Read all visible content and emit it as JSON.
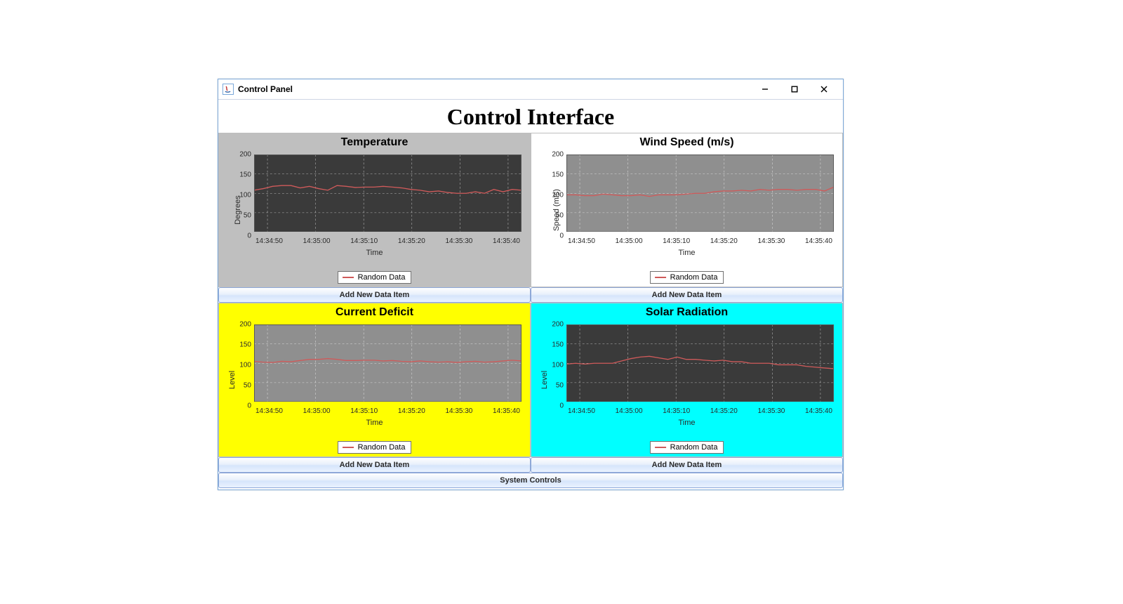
{
  "window": {
    "title": "Control Panel"
  },
  "header": {
    "title": "Control Interface"
  },
  "buttons": {
    "add_data": "Add New Data Item",
    "system_controls": "System Controls"
  },
  "chart_data": [
    {
      "id": "temperature",
      "type": "line",
      "title": "Temperature",
      "xlabel": "Time",
      "ylabel": "Degrees",
      "ylim": [
        0,
        200
      ],
      "yticks": [
        0,
        50,
        100,
        150,
        200
      ],
      "categories": [
        "14:34:50",
        "14:35:00",
        "14:35:10",
        "14:35:20",
        "14:35:30",
        "14:35:40"
      ],
      "series": [
        {
          "name": "Random Data",
          "color": "#cf5a5a",
          "x": [
            "14:34:46",
            "14:34:48",
            "14:34:50",
            "14:34:52",
            "14:34:54",
            "14:34:56",
            "14:34:58",
            "14:35:00",
            "14:35:02",
            "14:35:04",
            "14:35:06",
            "14:35:08",
            "14:35:10",
            "14:35:12",
            "14:35:14",
            "14:35:16",
            "14:35:18",
            "14:35:20",
            "14:35:22",
            "14:35:24",
            "14:35:26",
            "14:35:28",
            "14:35:30",
            "14:35:32",
            "14:35:34",
            "14:35:36",
            "14:35:38",
            "14:35:40",
            "14:35:42",
            "14:35:44"
          ],
          "values": [
            108,
            112,
            118,
            120,
            120,
            114,
            118,
            112,
            108,
            120,
            118,
            115,
            116,
            116,
            118,
            116,
            114,
            110,
            108,
            104,
            106,
            102,
            100,
            100,
            104,
            100,
            110,
            104,
            110,
            108
          ]
        }
      ],
      "panel_bg": "#bfbfbf",
      "plot_bg": "#3a3a3a",
      "grid_color": "#b5b5b5"
    },
    {
      "id": "wind",
      "type": "line",
      "title": "Wind Speed (m/s)",
      "xlabel": "Time",
      "ylabel": "Speed (m/s)",
      "ylim": [
        0,
        200
      ],
      "yticks": [
        0,
        50,
        100,
        150,
        200
      ],
      "categories": [
        "14:34:50",
        "14:35:00",
        "14:35:10",
        "14:35:20",
        "14:35:30",
        "14:35:40"
      ],
      "series": [
        {
          "name": "Random Data",
          "color": "#cf5a5a",
          "x": [
            "14:34:46",
            "14:34:48",
            "14:34:50",
            "14:34:52",
            "14:34:54",
            "14:34:56",
            "14:34:58",
            "14:35:00",
            "14:35:02",
            "14:35:04",
            "14:35:06",
            "14:35:08",
            "14:35:10",
            "14:35:12",
            "14:35:14",
            "14:35:16",
            "14:35:18",
            "14:35:20",
            "14:35:22",
            "14:35:24",
            "14:35:26",
            "14:35:28",
            "14:35:30",
            "14:35:32",
            "14:35:34",
            "14:35:36",
            "14:35:38",
            "14:35:40",
            "14:35:42",
            "14:35:44"
          ],
          "values": [
            96,
            96,
            94,
            94,
            98,
            96,
            94,
            94,
            96,
            92,
            96,
            96,
            96,
            98,
            100,
            100,
            104,
            106,
            106,
            108,
            106,
            110,
            108,
            110,
            110,
            108,
            110,
            110,
            106,
            116
          ]
        }
      ],
      "panel_bg": "#ffffff",
      "plot_bg": "#8f8f8f",
      "grid_color": "#d9d9d9"
    },
    {
      "id": "deficit",
      "type": "line",
      "title": "Current Deficit",
      "xlabel": "Time",
      "ylabel": "Level",
      "ylim": [
        0,
        200
      ],
      "yticks": [
        0,
        50,
        100,
        150,
        200
      ],
      "categories": [
        "14:34:50",
        "14:35:00",
        "14:35:10",
        "14:35:20",
        "14:35:30",
        "14:35:40"
      ],
      "series": [
        {
          "name": "Random Data",
          "color": "#cf5a5a",
          "x": [
            "14:34:46",
            "14:34:48",
            "14:34:50",
            "14:34:52",
            "14:34:54",
            "14:34:56",
            "14:34:58",
            "14:35:00",
            "14:35:02",
            "14:35:04",
            "14:35:06",
            "14:35:08",
            "14:35:10",
            "14:35:12",
            "14:35:14",
            "14:35:16",
            "14:35:18",
            "14:35:20",
            "14:35:22",
            "14:35:24",
            "14:35:26",
            "14:35:28",
            "14:35:30",
            "14:35:32",
            "14:35:34",
            "14:35:36",
            "14:35:38",
            "14:35:40",
            "14:35:42",
            "14:35:44"
          ],
          "values": [
            105,
            103,
            102,
            105,
            104,
            107,
            110,
            110,
            112,
            110,
            107,
            107,
            108,
            108,
            106,
            107,
            105,
            104,
            106,
            104,
            103,
            104,
            102,
            104,
            105,
            103,
            104,
            106,
            108,
            106
          ]
        }
      ],
      "panel_bg": "#ffff00",
      "plot_bg": "#8f8f8f",
      "grid_color": "#d9d9d9"
    },
    {
      "id": "solar",
      "type": "line",
      "title": "Solar Radiation",
      "xlabel": "Time",
      "ylabel": "Level",
      "ylim": [
        0,
        200
      ],
      "yticks": [
        0,
        50,
        100,
        150,
        200
      ],
      "categories": [
        "14:34:50",
        "14:35:00",
        "14:35:10",
        "14:35:20",
        "14:35:30",
        "14:35:40"
      ],
      "series": [
        {
          "name": "Random Data",
          "color": "#cf5a5a",
          "x": [
            "14:34:46",
            "14:34:48",
            "14:34:50",
            "14:34:52",
            "14:34:54",
            "14:34:56",
            "14:34:58",
            "14:35:00",
            "14:35:02",
            "14:35:04",
            "14:35:06",
            "14:35:08",
            "14:35:10",
            "14:35:12",
            "14:35:14",
            "14:35:16",
            "14:35:18",
            "14:35:20",
            "14:35:22",
            "14:35:24",
            "14:35:26",
            "14:35:28",
            "14:35:30",
            "14:35:32",
            "14:35:34",
            "14:35:36",
            "14:35:38",
            "14:35:40",
            "14:35:42",
            "14:35:44"
          ],
          "values": [
            98,
            100,
            98,
            100,
            100,
            100,
            106,
            112,
            116,
            118,
            114,
            110,
            116,
            110,
            110,
            108,
            106,
            108,
            104,
            104,
            100,
            100,
            100,
            96,
            96,
            96,
            92,
            90,
            88,
            86
          ]
        }
      ],
      "panel_bg": "#00ffff",
      "plot_bg": "#3a3a3a",
      "grid_color": "#b5b5b5"
    }
  ]
}
